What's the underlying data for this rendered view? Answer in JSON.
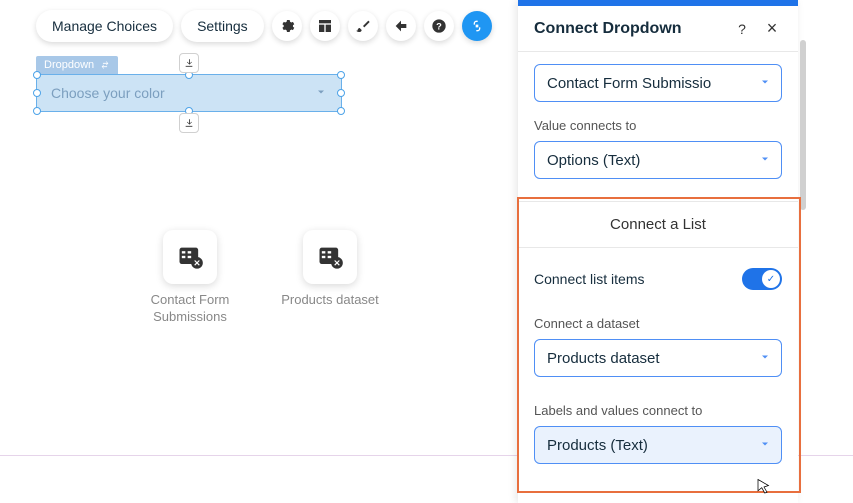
{
  "toolbar": {
    "manage_choices": "Manage Choices",
    "settings": "Settings"
  },
  "canvas": {
    "element_label": "Dropdown",
    "placeholder": "Choose your color"
  },
  "datasets": [
    {
      "name": "Contact Form Submissions"
    },
    {
      "name": "Products dataset"
    }
  ],
  "panel": {
    "title": "Connect Dropdown",
    "dataset_select": "Contact Form Submissio",
    "value_label": "Value connects to",
    "value_select": "Options (Text)",
    "list_header": "Connect a List",
    "connect_list_items": "Connect list items",
    "connect_dataset_label": "Connect a dataset",
    "connect_dataset_select": "Products dataset",
    "labels_values_label": "Labels and values connect to",
    "labels_values_select": "Products (Text)"
  }
}
